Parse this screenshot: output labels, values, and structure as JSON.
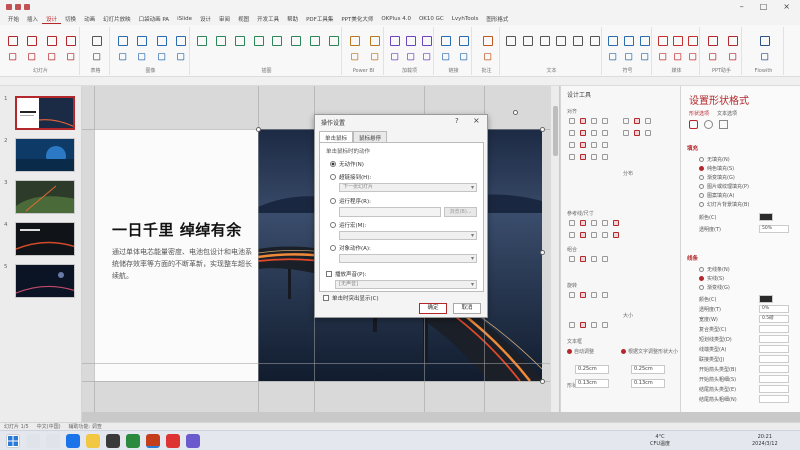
{
  "menubar": {
    "tabs": [
      "开始",
      "插入",
      "设计",
      "切换",
      "动画",
      "幻灯片放映",
      "口袋动画 PA",
      "iSlide",
      "设计",
      "审阅",
      "视图",
      "开发工具",
      "帮助",
      "PDF工具集",
      "PPT美化大师",
      "OKPlus 4.0",
      "OK10 GC",
      "LvyhTools",
      "图形格式"
    ],
    "active_index": 2
  },
  "ribbon": {
    "group_labels": [
      "幻灯片",
      "表格",
      "图像",
      "插图",
      "Power BI",
      "加载项",
      "链接",
      "批注",
      "文本",
      "符号",
      "媒体",
      "PPT助手",
      "Flowith"
    ]
  },
  "slide_panel": {
    "numbers": [
      "1",
      "2",
      "3",
      "4",
      "5"
    ]
  },
  "slide": {
    "title": "一日千里 绰绰有余",
    "body": "通过单体电芯能量密度、电池包设计和电池系统储存效率等方面的不断革新，实现整车超长续航。"
  },
  "dialog": {
    "title": "操作设置",
    "tabs": [
      "单击鼠标",
      "鼠标悬停"
    ],
    "section_label": "单击鼠标时的动作",
    "options": {
      "none": "无动作(N)",
      "hyperlink": "超链接到(H):",
      "hyperlink_value": "下一张幻灯片",
      "run_program": "运行程序(R):",
      "browse": "浏览(B)...",
      "run_macro": "运行宏(M):",
      "object_action": "对象动作(A):",
      "play_sound": "播放声音(P):",
      "sound_value": "[无声音]",
      "highlight": "单击时突出显示(C)"
    },
    "ok": "确定",
    "cancel": "取消"
  },
  "design_pane": {
    "title": "设计工具",
    "sections": [
      "对齐",
      "分布",
      "参考线/尺寸",
      "组合",
      "旋转",
      "大小",
      "文本框",
      "形状"
    ],
    "checks": [
      "自动调整",
      "根据文字调整形状大小"
    ],
    "inputs": [
      "0.25cm",
      "0.25cm",
      "0.13cm",
      "0.13cm"
    ]
  },
  "format_pane": {
    "title": "设置形状格式",
    "tabs": [
      "形状选项",
      "文本选项"
    ],
    "fill_section": "填充",
    "fill_options": [
      "无填充(N)",
      "纯色填充(S)",
      "渐变填充(G)",
      "图片或纹理填充(P)",
      "图案填充(A)",
      "幻灯片背景填充(B)"
    ],
    "fill_color_label": "颜色(C)",
    "fill_transparency_label": "透明度(T)",
    "fill_transparency_value": "50%",
    "line_section": "线条",
    "line_options": [
      "无线条(N)",
      "实线(S)",
      "渐变线(G)"
    ],
    "line_props": [
      "颜色(C)",
      "透明度(T)",
      "宽度(W)",
      "复合类型(C)",
      "短划线类型(D)",
      "线端类型(A)",
      "联接类型(J)",
      "开始箭头类型(B)",
      "开始箭头粗细(S)",
      "结尾箭头类型(E)",
      "结尾箭头粗细(N)"
    ],
    "line_values": [
      "",
      "0%",
      "0.5磅"
    ]
  },
  "statusbar": {
    "items": [
      "幻灯片 1/5",
      "中文(中国)",
      "辅助功能: 调查"
    ]
  },
  "taskbar": {
    "weather_temp": "4°C",
    "weather_desc": "CFU温度",
    "time": "20:21",
    "date": "2024/3/12"
  },
  "colors": {
    "accent": "#b4282c",
    "slide_title": "#111111"
  }
}
